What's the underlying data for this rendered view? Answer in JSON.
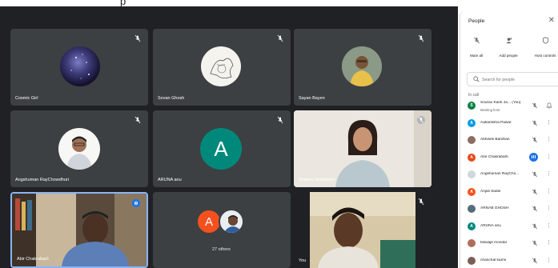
{
  "window": {
    "title_fragment": "p"
  },
  "tiles": [
    {
      "name": "Cosmic Girl"
    },
    {
      "name": "Sovan Ghosh"
    },
    {
      "name": "Sayan Bayen"
    },
    {
      "name": "Angshuman RayChowdhuri"
    },
    {
      "name": "ARUNA anu",
      "avatar_letter": "A",
      "avatar_color": "#00897b"
    },
    {
      "name": "Sritama Mukherjee"
    },
    {
      "name": "Abir Chakrabarti"
    },
    {
      "name": "27 others",
      "avatar_letter": "A",
      "avatar_color": "#f4511e"
    },
    {
      "name": "You"
    }
  ],
  "panel": {
    "title": "People",
    "actions": [
      "Mute all",
      "Add people",
      "Host controls"
    ],
    "search_placeholder": "Search for people",
    "section_label": "In call",
    "participants": [
      {
        "name": "Sourav Kanti Ja...",
        "tag": "(You)",
        "sub": "Meeting host",
        "initial": "S",
        "color": "#0b8043"
      },
      {
        "name": "Aakanksha Pawar",
        "initial": "A",
        "color": "#039be5"
      },
      {
        "name": "Abhisek Bardhan",
        "initial": "",
        "color": "#8d6e63"
      },
      {
        "name": "Abir Chakrabarti",
        "initial": "A",
        "color": "#e64a19"
      },
      {
        "name": "Angshuman RayCho...",
        "initial": "",
        "color": "#cfd8dc"
      },
      {
        "name": "Anjali Sadie",
        "initial": "A",
        "color": "#f4511e"
      },
      {
        "name": "ARNAB GHOSH",
        "initial": "",
        "color": "#546e7a"
      },
      {
        "name": "ARUNA anu",
        "initial": "A",
        "color": "#00897b"
      },
      {
        "name": "biswajit mondal",
        "initial": "",
        "color": "#b06d5a"
      },
      {
        "name": "chanchal karmi",
        "initial": "",
        "color": "#7b5e57"
      }
    ]
  },
  "colors": {
    "stage": "#202124",
    "tile": "#3c4043",
    "accent": "#1a73e8",
    "speaking_border": "#8ab4f8"
  }
}
